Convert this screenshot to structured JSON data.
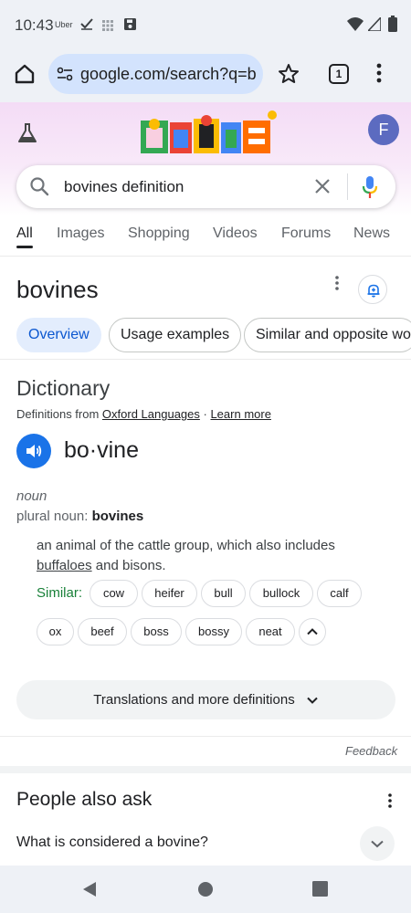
{
  "status": {
    "time": "10:43",
    "app_label": "Uber"
  },
  "browser": {
    "url": "google.com/search?q=b",
    "tab_count": "1"
  },
  "profile": {
    "initial": "F"
  },
  "search": {
    "query": "bovines definition"
  },
  "nav_tabs": [
    "All",
    "Images",
    "Shopping",
    "Videos",
    "Forums",
    "News"
  ],
  "result": {
    "title": "bovines"
  },
  "chips": [
    "Overview",
    "Usage examples",
    "Similar and opposite wo"
  ],
  "dictionary": {
    "title": "Dictionary",
    "source_prefix": "Definitions from ",
    "source_name": "Oxford Languages",
    "source_sep": " · ",
    "learn_more": "Learn more",
    "headword": "bo·vine",
    "pos": "noun",
    "plural_prefix": "plural noun: ",
    "plural_word": "bovines",
    "definition_pre": "an animal of the cattle group, which also includes ",
    "definition_link": "buffaloes",
    "definition_post": " and bisons.",
    "similar_label": "Similar:",
    "synonyms": [
      "cow",
      "heifer",
      "bull",
      "bullock",
      "calf",
      "ox",
      "beef",
      "boss",
      "bossy",
      "neat"
    ],
    "more_definitions": "Translations and more definitions"
  },
  "feedback": "Feedback",
  "people_also_ask": {
    "title": "People also ask",
    "question": "What is considered a bovine?"
  },
  "colors": {
    "accent_blue": "#1a73e8",
    "similar_green": "#188038",
    "header_pink": "#f4dcf6"
  }
}
